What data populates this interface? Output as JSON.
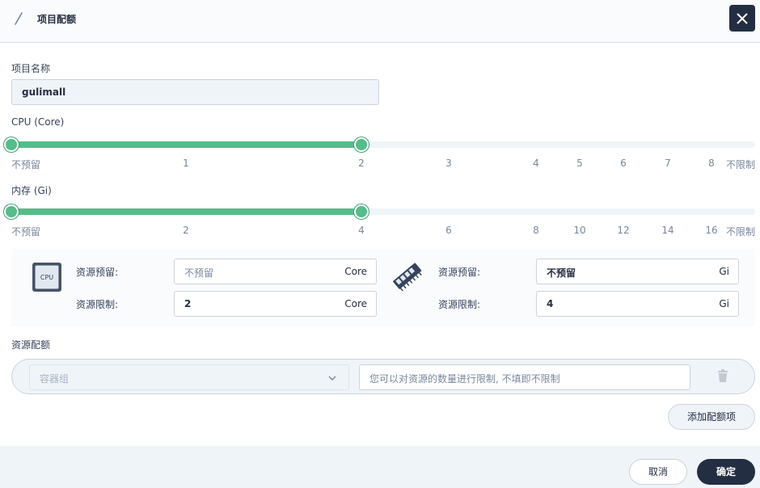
{
  "header": {
    "title": "项目配额",
    "edit_icon": "pen-icon",
    "close_icon": "close-icon"
  },
  "project_name": {
    "label": "项目名称",
    "value": "gulimall"
  },
  "cpu": {
    "label": "CPU (Core)",
    "ticks": [
      "不预留",
      "1",
      "2",
      "3",
      "4",
      "5",
      "6",
      "7",
      "8",
      "不限制"
    ],
    "reservation": "不预留",
    "limit": "2"
  },
  "memory": {
    "label": "内存 (Gi)",
    "ticks": [
      "不预留",
      "2",
      "4",
      "6",
      "8",
      "10",
      "12",
      "14",
      "16",
      "不限制"
    ],
    "reservation": "不预留",
    "limit": "4"
  },
  "resource_panel": {
    "cpu_icon_text": "CPU",
    "cpu_reserve_label": "资源预留:",
    "cpu_reserve_value": "不预留",
    "cpu_reserve_unit": "Core",
    "cpu_limit_label": "资源限制:",
    "cpu_limit_value": "2",
    "cpu_limit_unit": "Core",
    "mem_reserve_label": "资源预留:",
    "mem_reserve_value": "不预留",
    "mem_reserve_unit": "Gi",
    "mem_limit_label": "资源限制:",
    "mem_limit_value": "4",
    "mem_limit_unit": "Gi"
  },
  "quota": {
    "label": "资源配额",
    "select_value": "容器组",
    "input_placeholder": "您可以对资源的数量进行限制, 不填即不限制",
    "add_label": "添加配额项"
  },
  "footer": {
    "cancel_label": "取消",
    "ok_label": "确定"
  },
  "colors": {
    "accent": "#55bc8a",
    "dark": "#242e42",
    "panel": "#f9fbfd",
    "muted": "#79879c"
  }
}
